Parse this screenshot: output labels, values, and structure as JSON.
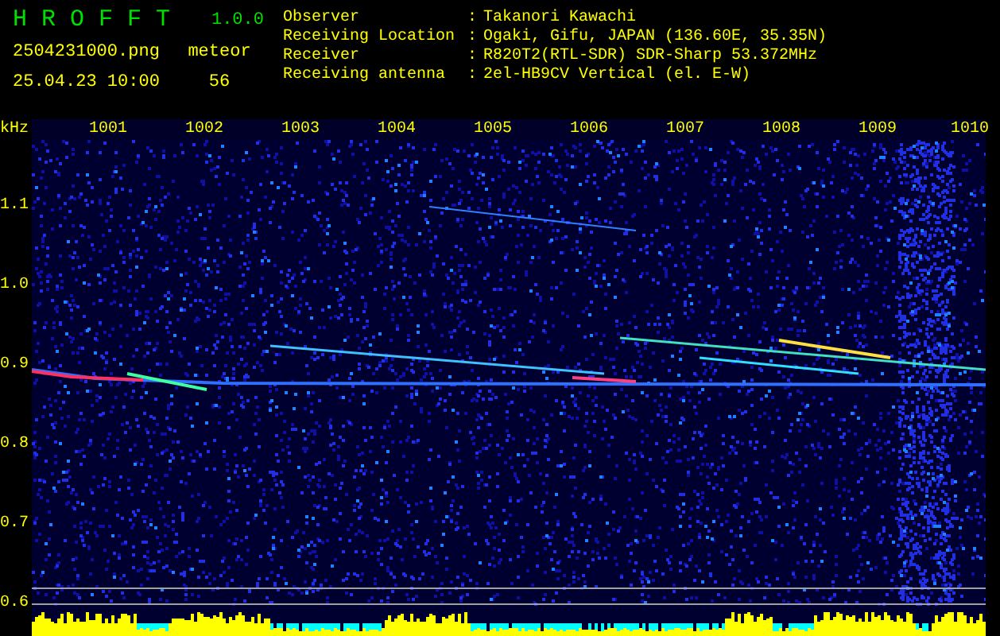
{
  "header": {
    "app_name": "H R O F F T",
    "version": "1.0.0",
    "file_name": "2504231000.png",
    "datetime": "25.04.23 10:00",
    "meteor_label": "meteor",
    "meteor_count": "56"
  },
  "info": [
    {
      "label": "Observer",
      "separator": ":",
      "value": "Takanori Kawachi"
    },
    {
      "label": "Receiving Location",
      "separator": ":",
      "value": "Ogaki, Gifu, JAPAN (136.60E, 35.35N)"
    },
    {
      "label": "Receiver",
      "separator": ":",
      "value": "R820T2(RTL-SDR) SDR-Sharp 53.372MHz"
    },
    {
      "label": "Receiving antenna",
      "separator": ":",
      "value": "2el-HB9CV Vertical (el. E-W)"
    }
  ],
  "y_axis": {
    "unit": "kHz",
    "ticks": [
      "1.1",
      "1.0",
      "0.9",
      "0.8",
      "0.7",
      "0.6"
    ]
  },
  "x_axis": {
    "ticks": [
      "1001",
      "1002",
      "1003",
      "1004",
      "1005",
      "1006",
      "1007",
      "1008",
      "1009",
      "1010"
    ]
  }
}
